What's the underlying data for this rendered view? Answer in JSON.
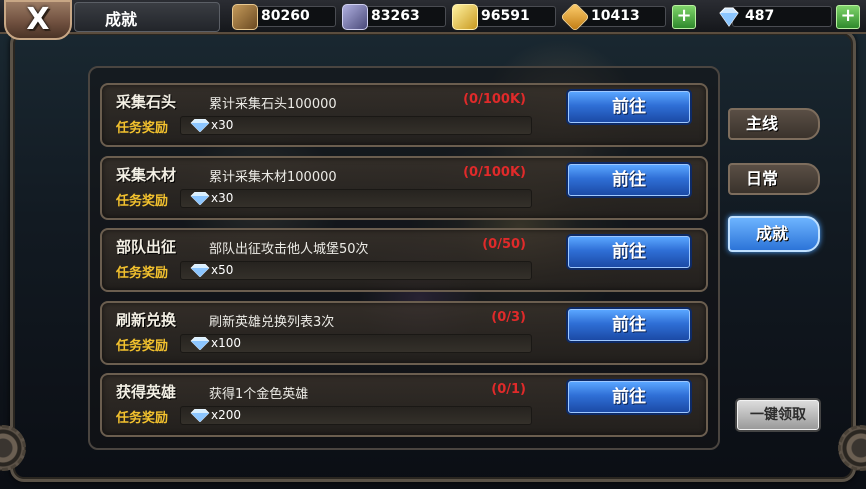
{
  "header": {
    "close_label": "X",
    "title": "成就",
    "resources": [
      {
        "icon": "wood-icon",
        "value": "80260",
        "color": "#8a6a3a"
      },
      {
        "icon": "stone-icon",
        "value": "83263",
        "color": "#6a6a9a"
      },
      {
        "icon": "gold-ore-icon",
        "value": "96591",
        "color": "#e0b838"
      },
      {
        "icon": "gold-icon",
        "value": "10413",
        "color": "#e6a42a"
      }
    ],
    "diamond": {
      "icon": "diamond-icon",
      "value": "487"
    }
  },
  "tasks": [
    {
      "name": "采集石头",
      "desc": "累计采集石头100000",
      "progress": "(0/100K)",
      "reward_label": "任务奖励",
      "reward_qty": "x30",
      "button": "前往"
    },
    {
      "name": "采集木材",
      "desc": "累计采集木材100000",
      "progress": "(0/100K)",
      "reward_label": "任务奖励",
      "reward_qty": "x30",
      "button": "前往"
    },
    {
      "name": "部队出征",
      "desc": "部队出征攻击他人城堡50次",
      "progress": "(0/50)",
      "reward_label": "任务奖励",
      "reward_qty": "x50",
      "button": "前往"
    },
    {
      "name": "刷新兑换",
      "desc": "刷新英雄兑换列表3次",
      "progress": "(0/3)",
      "reward_label": "任务奖励",
      "reward_qty": "x100",
      "button": "前往"
    },
    {
      "name": "获得英雄",
      "desc": "获得1个金色英雄",
      "progress": "(0/1)",
      "reward_label": "任务奖励",
      "reward_qty": "x200",
      "button": "前往"
    }
  ],
  "tabs": [
    {
      "label": "主线",
      "active": false
    },
    {
      "label": "日常",
      "active": false
    },
    {
      "label": "成就",
      "active": true
    }
  ],
  "claim_all_label": "一键领取",
  "colors": {
    "accent_blue": "#2f6fd6",
    "progress_red": "#e02a2a",
    "reward_gold": "#f2c12e",
    "plus_green": "#3aa235"
  }
}
